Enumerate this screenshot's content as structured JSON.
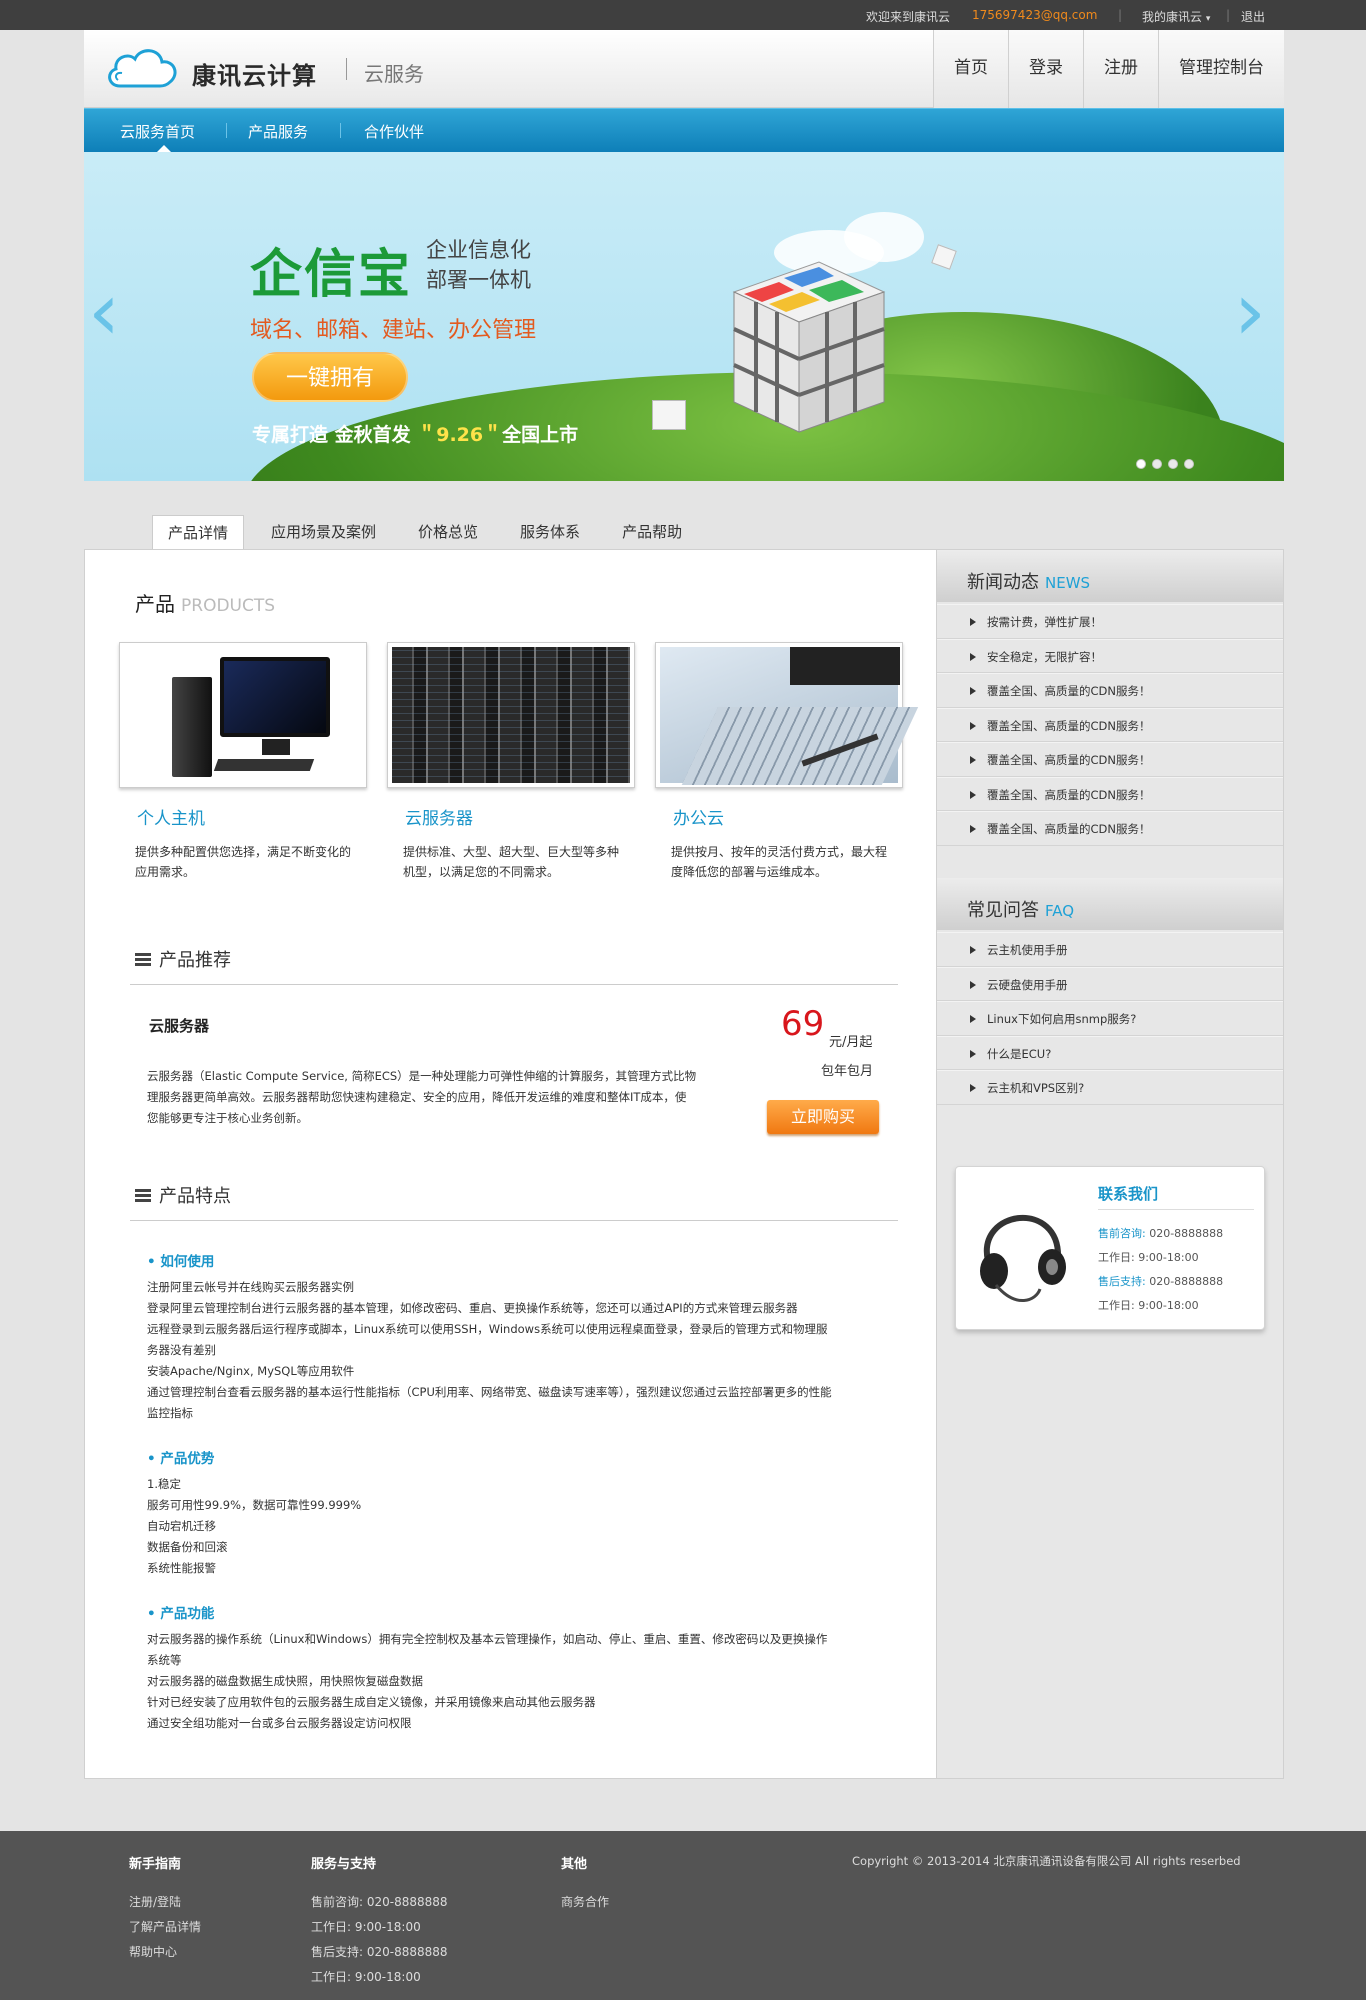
{
  "topbar": {
    "welcome": "欢迎来到康讯云",
    "email": "175697423@qq.com",
    "separator": "|",
    "my_cloud": "我的康讯云",
    "logout": "退出"
  },
  "header": {
    "logo_text": "康讯云计算",
    "logo_sub": "云服务",
    "nav": [
      "首页",
      "登录",
      "注册",
      "管理控制台"
    ]
  },
  "subnav": [
    "云服务首页",
    "产品服务",
    "合作伙伴"
  ],
  "banner": {
    "brand": "企信宝",
    "brand_sub_1": "企业信息化",
    "brand_sub_2": "部署一体机",
    "line": "域名、邮箱、建站、办公管理",
    "button": "一键拥有",
    "bottom_1": "专属打造  金秋首发  ",
    "bottom_date": "＂9.26＂",
    "bottom_2": "全国上市",
    "prev_icon": "chevron-left-icon",
    "next_icon": "chevron-right-icon",
    "slide_count": 4,
    "active_slide": 1
  },
  "tabs": [
    "产品详情",
    "应用场景及案例",
    "价格总览",
    "服务体系",
    "产品帮助"
  ],
  "products": {
    "title": "产品",
    "title_en": "PRODUCTS",
    "items": [
      {
        "name": "个人主机",
        "desc": "提供多种配置供您选择，满足不断变化的应用需求。"
      },
      {
        "name": "云服务器",
        "desc": "提供标准、大型、超大型、巨大型等多种机型，以满足您的不同需求。"
      },
      {
        "name": "办公云",
        "desc": "提供按月、按年的灵活付费方式，最大程度降低您的部署与运维成本。"
      }
    ]
  },
  "recommend": {
    "heading": "产品推荐",
    "title": "云服务器",
    "desc": "云服务器（Elastic Compute Service, 简称ECS）是一种处理能力可弹性伸缩的计算服务，其管理方式比物理服务器更简单高效。云服务器帮助您快速构建稳定、安全的应用，降低开发运维的难度和整体IT成本，使您能够更专注于核心业务创新。",
    "price": "69",
    "price_unit": "元/月起",
    "price_sub": "包年包月",
    "buy": "立即购买"
  },
  "features": {
    "heading": "产品特点",
    "sections": [
      {
        "title": "• 如何使用",
        "lines": [
          "注册阿里云帐号并在线购买云服务器实例",
          "登录阿里云管理控制台进行云服务器的基本管理，如修改密码、重启、更换操作系统等，您还可以通过API的方式来管理云服务器",
          "远程登录到云服务器后运行程序或脚本，Linux系统可以使用SSH，Windows系统可以使用远程桌面登录，登录后的管理方式和物理服务器没有差别",
          "安装Apache/Nginx, MySQL等应用软件",
          "通过管理控制台查看云服务器的基本运行性能指标（CPU利用率、网络带宽、磁盘读写速率等），强烈建议您通过云监控部署更多的性能监控指标"
        ]
      },
      {
        "title": "• 产品优势",
        "lines": [
          "1.稳定",
          "服务可用性99.9%，数据可靠性99.999%",
          "自动宕机迁移",
          "数据备份和回滚",
          "系统性能报警"
        ]
      },
      {
        "title": "• 产品功能",
        "lines": [
          "对云服务器的操作系统（Linux和Windows）拥有完全控制权及基本云管理操作，如启动、停止、重启、重置、修改密码以及更换操作系统等",
          "对云服务器的磁盘数据生成快照，用快照恢复磁盘数据",
          "针对已经安装了应用软件包的云服务器生成自定义镜像，并采用镜像来启动其他云服务器",
          "通过安全组功能对一台或多台云服务器设定访问权限"
        ]
      }
    ]
  },
  "news": {
    "title": "新闻动态",
    "title_en": "NEWS",
    "items": [
      "按需计费，弹性扩展！",
      "安全稳定，无限扩容！",
      "覆盖全国、高质量的CDN服务！",
      "覆盖全国、高质量的CDN服务！",
      "覆盖全国、高质量的CDN服务！",
      "覆盖全国、高质量的CDN服务！",
      "覆盖全国、高质量的CDN服务！"
    ]
  },
  "faq": {
    "title": "常见问答",
    "title_en": "FAQ",
    "items": [
      "云主机使用手册",
      "云硬盘使用手册",
      "Linux下如何启用snmp服务?",
      "什么是ECU?",
      "云主机和VPS区别?"
    ]
  },
  "contact": {
    "title": "联系我们",
    "presale_label": "售前咨询:",
    "presale": "020-8888888",
    "hours1": "工作日: 9:00-18:00",
    "aftersale_label": "售后支持:",
    "aftersale": "020-8888888",
    "hours2": "工作日: 9:00-18:00"
  },
  "footer": {
    "col1": {
      "title": "新手指南",
      "items": [
        "注册/登陆",
        "了解产品详情",
        "帮助中心"
      ]
    },
    "col2": {
      "title": "服务与支持",
      "items": [
        "售前咨询: 020-8888888",
        "工作日: 9:00-18:00",
        "售后支持: 020-8888888",
        "工作日: 9:00-18:00"
      ]
    },
    "col3": {
      "title": "其他",
      "items": [
        "商务合作"
      ]
    },
    "copyright": "Copyright © 2013-2014  北京康讯通讯设备有限公司   All rights reserbed"
  },
  "colors": {
    "accent": "#1994c9",
    "price": "#d8161c",
    "buy": "#f07811"
  }
}
